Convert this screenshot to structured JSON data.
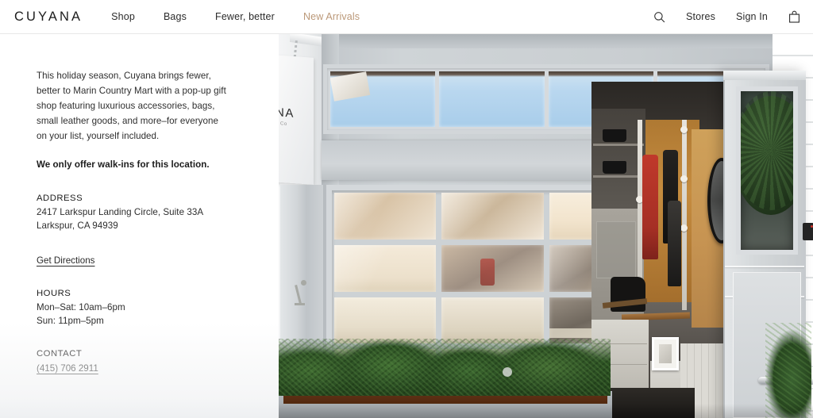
{
  "header": {
    "brand": "CUYANA",
    "nav_main": [
      {
        "label": "Shop",
        "accent": false
      },
      {
        "label": "Bags",
        "accent": false
      },
      {
        "label": "Fewer, better",
        "accent": false
      },
      {
        "label": "New Arrivals",
        "accent": true
      }
    ],
    "accent_color": "#bb9878",
    "search_icon": "search-icon",
    "stores_label": "Stores",
    "signin_label": "Sign In",
    "bag_icon": "shopping-bag-icon"
  },
  "info": {
    "intro": "This holiday season, Cuyana brings fewer, better to Marin Country Mart with a pop-up gift shop featuring luxurious accessories, bags, small leather goods, and more–for everyone on your list, yourself included.",
    "walkins_note": "We only offer walk-ins for this location.",
    "address_label": "ADDRESS",
    "address_line1": "2417 Larkspur Landing Circle, Suite 33A",
    "address_line2": "Larkspur, CA 94939",
    "directions_link": "Get Directions",
    "hours_label": "HOURS",
    "hours_line1": "Mon–Sat: 10am–6pm",
    "hours_line2": "Sun: 11pm–5pm",
    "contact_label": "CONTACT",
    "contact_phone": "(415) 706 2911"
  },
  "photo": {
    "sign_text": "NA",
    "sign_sub": "Co"
  }
}
